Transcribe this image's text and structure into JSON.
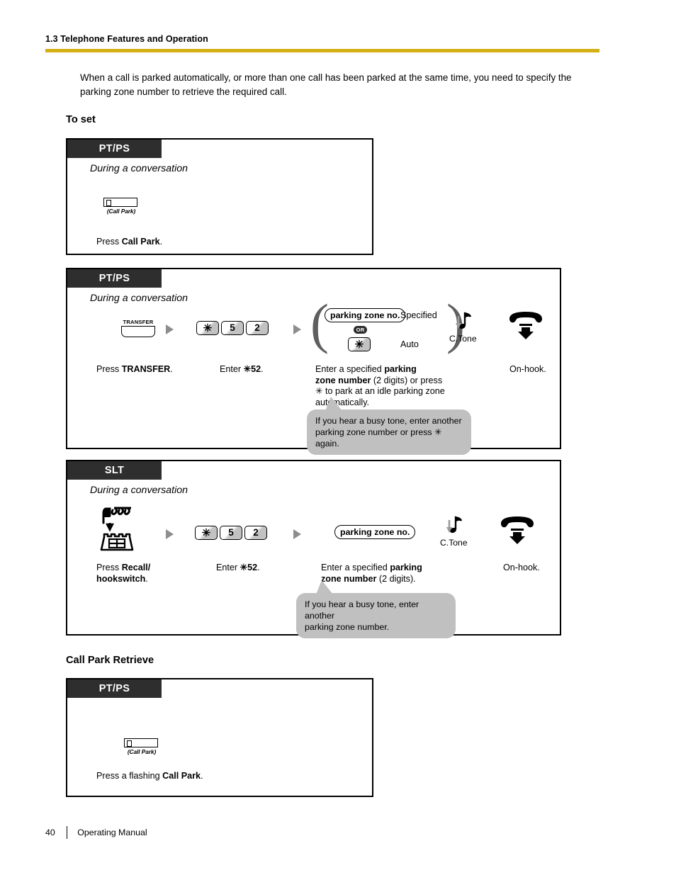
{
  "header": {
    "section": "1.3 Telephone Features and Operation",
    "rule_color": "#d4b016"
  },
  "intro": "When a call is parked automatically, or more than one call has been parked at the same time, you need to specify the parking zone number to retrieve the required call.",
  "headings": {
    "to_set": "To set",
    "call_park_retrieve": "Call Park Retrieve"
  },
  "box1": {
    "tab": "PT/PS",
    "state": "During a conversation",
    "key_label": "(Call Park)",
    "caption_pre": "Press ",
    "caption_bold": "Call Park",
    "caption_post": "."
  },
  "box2": {
    "tab": "PT/PS",
    "state": "During a conversation",
    "transfer_label": "TRANSFER",
    "keys": [
      "✳",
      "5",
      "2"
    ],
    "pill": "parking zone no.",
    "or_badge": "OR",
    "star_key": "✳",
    "label_specified": "Specified",
    "label_auto": "Auto",
    "ctone": "C.Tone",
    "step1_pre": "Press ",
    "step1_bold": "TRANSFER",
    "step1_post": ".",
    "step2_pre": "Enter ",
    "step2_bold": "✳52",
    "step2_post": ".",
    "step3_line1_pre": "Enter a specified ",
    "step3_line1_bold": "parking",
    "step3_line2_bold": "zone number",
    "step3_line2_post": " (2 digits) or press",
    "step3_line3": "✳ to park at an idle parking zone",
    "step3_line4": "automatically.",
    "step4": "On-hook.",
    "bubble_line1": "If you hear a busy tone, enter another",
    "bubble_line2": "parking zone number or press ✳ again."
  },
  "box3": {
    "tab": "SLT",
    "state": "During a conversation",
    "keys": [
      "✳",
      "5",
      "2"
    ],
    "pill": "parking zone no.",
    "ctone": "C.Tone",
    "step1_pre": "Press ",
    "step1_bold_line1": "Recall/",
    "step1_bold_line2": "hookswitch",
    "step1_post": ".",
    "step2_pre": "Enter ",
    "step2_bold": "✳52",
    "step2_post": ".",
    "step3_line1_pre": "Enter a specified ",
    "step3_line1_bold": "parking",
    "step3_line2_bold": "zone number",
    "step3_line2_post": " (2 digits).",
    "step4": "On-hook.",
    "bubble_line1": "If you hear a busy tone, enter another",
    "bubble_line2": "parking zone number."
  },
  "box4": {
    "tab": "PT/PS",
    "key_label": "(Call Park)",
    "caption_pre": "Press a flashing ",
    "caption_bold": "Call Park",
    "caption_post": "."
  },
  "footer": {
    "page_number": "40",
    "title": "Operating Manual"
  }
}
